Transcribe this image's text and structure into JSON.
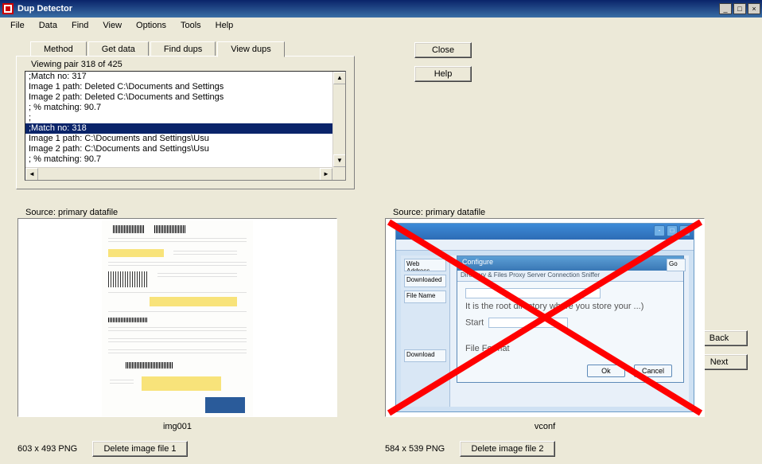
{
  "window": {
    "title": "Dup Detector"
  },
  "menu": [
    "File",
    "Data",
    "Find",
    "View",
    "Options",
    "Tools",
    "Help"
  ],
  "tabs": [
    "Method",
    "Get data",
    "Find dups",
    "View dups"
  ],
  "pair_label": "Viewing pair 318 of 425",
  "list": [
    ";Match no: 317",
    "Image 1 path: Deleted C:\\Documents and Settings",
    "Image 2 path: Deleted C:\\Documents and Settings",
    "; % matching: 90.7",
    ";",
    ";Match no: 318",
    "Image 1 path: C:\\Documents and Settings\\Usu",
    "Image 2 path: C:\\Documents and Settings\\Usu",
    "; % matching: 90.7",
    "."
  ],
  "list_selected_index": 5,
  "buttons": {
    "close": "Close",
    "help": "Help",
    "back": "Back",
    "next": "Next",
    "delete1": "Delete image file 1",
    "delete2": "Delete image file 2"
  },
  "image1": {
    "source": "Source: primary datafile",
    "name": "img001",
    "dims": "603 x 493 PNG"
  },
  "image2": {
    "source": "Source: primary datafile",
    "name": "vconf",
    "dims": "584 x 539 PNG"
  },
  "vconf": {
    "dialog_title": "Configure",
    "tabs": "Directory & Files   Proxy Server   Connection   Sniffer",
    "hint": "It is the root directory where you store your ...)",
    "side": [
      "Web Address",
      "Downloaded",
      "File Name",
      "Download"
    ],
    "start": "Start",
    "fileformat": "File Format",
    "ok": "Ok",
    "cancel": "Cancel",
    "go": "Go"
  }
}
